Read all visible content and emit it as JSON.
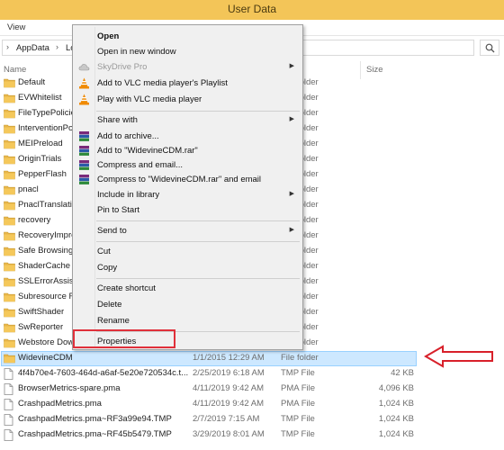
{
  "window": {
    "title": "User Data"
  },
  "menubar": {
    "view": "View"
  },
  "address": {
    "crumb1": "AppData",
    "crumb2": "Lo"
  },
  "columns": {
    "name": "Name",
    "type": "Type",
    "size": "Size"
  },
  "files": [
    {
      "name": "Default",
      "date": "",
      "type": "File folder",
      "size": "",
      "kind": "folder"
    },
    {
      "name": "EVWhitelist",
      "date": "",
      "type": "File folder",
      "size": "",
      "kind": "folder"
    },
    {
      "name": "FileTypePolicies",
      "date": "",
      "type": "File folder",
      "size": "",
      "kind": "folder"
    },
    {
      "name": "InterventionPolicyDatabase",
      "date": "",
      "type": "File folder",
      "size": "",
      "kind": "folder"
    },
    {
      "name": "MEIPreload",
      "date": "",
      "type": "File folder",
      "size": "",
      "kind": "folder"
    },
    {
      "name": "OriginTrials",
      "date": "",
      "type": "File folder",
      "size": "",
      "kind": "folder"
    },
    {
      "name": "PepperFlash",
      "date": "",
      "type": "File folder",
      "size": "",
      "kind": "folder"
    },
    {
      "name": "pnacl",
      "date": "",
      "type": "File folder",
      "size": "",
      "kind": "folder"
    },
    {
      "name": "PnaclTranslationCache",
      "date": "",
      "type": "File folder",
      "size": "",
      "kind": "folder"
    },
    {
      "name": "recovery",
      "date": "",
      "type": "File folder",
      "size": "",
      "kind": "folder"
    },
    {
      "name": "RecoveryImproved",
      "date": "",
      "type": "File folder",
      "size": "",
      "kind": "folder"
    },
    {
      "name": "Safe Browsing",
      "date": "",
      "type": "File folder",
      "size": "",
      "kind": "folder"
    },
    {
      "name": "ShaderCache",
      "date": "",
      "type": "File folder",
      "size": "",
      "kind": "folder"
    },
    {
      "name": "SSLErrorAssistant",
      "date": "",
      "type": "File folder",
      "size": "",
      "kind": "folder"
    },
    {
      "name": "Subresource Filter",
      "date": "",
      "type": "File folder",
      "size": "",
      "kind": "folder"
    },
    {
      "name": "SwiftShader",
      "date": "",
      "type": "File folder",
      "size": "",
      "kind": "folder"
    },
    {
      "name": "SwReporter",
      "date": "",
      "type": "File folder",
      "size": "",
      "kind": "folder"
    },
    {
      "name": "Webstore Downloads",
      "date": "",
      "type": "File folder",
      "size": "",
      "kind": "folder"
    },
    {
      "name": "WidevineCDM",
      "date": "1/1/2015 12:29 AM",
      "type": "File folder",
      "size": "",
      "kind": "folder",
      "selected": true
    },
    {
      "name": "4f4b70e4-7603-464d-a6af-5e20e720534c.t...",
      "date": "2/25/2019 6:18 AM",
      "type": "TMP File",
      "size": "42 KB",
      "kind": "file"
    },
    {
      "name": "BrowserMetrics-spare.pma",
      "date": "4/11/2019 9:42 AM",
      "type": "PMA File",
      "size": "4,096 KB",
      "kind": "file"
    },
    {
      "name": "CrashpadMetrics.pma",
      "date": "4/11/2019 9:42 AM",
      "type": "PMA File",
      "size": "1,024 KB",
      "kind": "file"
    },
    {
      "name": "CrashpadMetrics.pma~RF3a99e94.TMP",
      "date": "2/7/2019 7:15 AM",
      "type": "TMP File",
      "size": "1,024 KB",
      "kind": "file"
    },
    {
      "name": "CrashpadMetrics.pma~RF45b5479.TMP",
      "date": "3/29/2019 8:01 AM",
      "type": "TMP File",
      "size": "1,024 KB",
      "kind": "file"
    }
  ],
  "context_menu": {
    "open": "Open",
    "open_new_window": "Open in new window",
    "skydrive": "SkyDrive Pro",
    "vlc_playlist": "Add to VLC media player's Playlist",
    "vlc_play": "Play with VLC media player",
    "share_with": "Share with",
    "add_archive": "Add to archive...",
    "add_rar": "Add to \"WidevineCDM.rar\"",
    "compress_email": "Compress and email...",
    "compress_rar_email": "Compress to \"WidevineCDM.rar\" and email",
    "include_library": "Include in library",
    "pin_start": "Pin to Start",
    "send_to": "Send to",
    "cut": "Cut",
    "copy": "Copy",
    "create_shortcut": "Create shortcut",
    "delete": "Delete",
    "rename": "Rename",
    "properties": "Properties"
  },
  "colors": {
    "titlebar": "#f3c558",
    "selection": "#cde8ff",
    "highlight": "#e0303a",
    "folder": "#f5c85a"
  }
}
